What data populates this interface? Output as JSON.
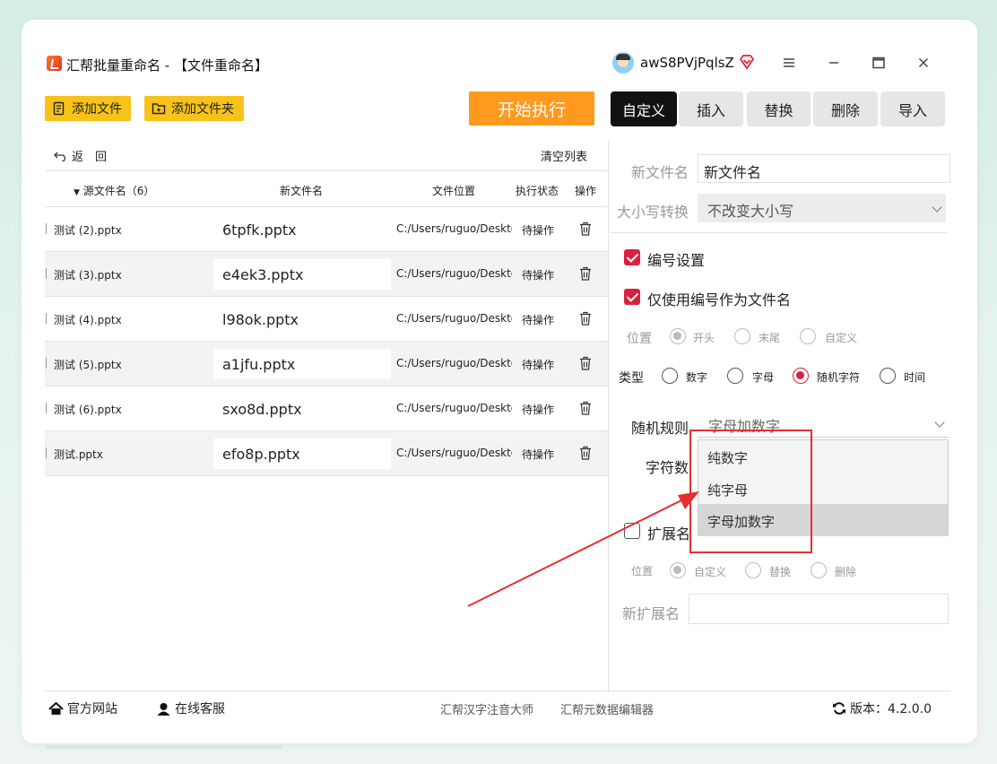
{
  "window": {
    "title": "汇帮批量重命名 - 【文件重命名】",
    "username": "awS8PVjPqlsZ"
  },
  "toolbar": {
    "add_file": "添加文件",
    "add_folder": "添加文件夹",
    "execute": "开始执行"
  },
  "tabs": [
    "自定义",
    "插入",
    "替换",
    "删除",
    "导入"
  ],
  "list": {
    "back": "返　回",
    "clear": "清空列表",
    "headers": {
      "source": "源文件名（6）",
      "new_name": "新文件名",
      "location": "文件位置",
      "status": "执行状态",
      "action": "操作"
    },
    "rows": [
      {
        "source": "测试 (2).pptx",
        "new_name": "6tpfk.pptx",
        "location": "C:/Users/ruguo/Desktop",
        "status": "待操作"
      },
      {
        "source": "测试 (3).pptx",
        "new_name": "e4ek3.pptx",
        "location": "C:/Users/ruguo/Desktop",
        "status": "待操作"
      },
      {
        "source": "测试 (4).pptx",
        "new_name": "l98ok.pptx",
        "location": "C:/Users/ruguo/Desktop",
        "status": "待操作"
      },
      {
        "source": "测试 (5).pptx",
        "new_name": "a1jfu.pptx",
        "location": "C:/Users/ruguo/Desktop",
        "status": "待操作"
      },
      {
        "source": "测试 (6).pptx",
        "new_name": "sxo8d.pptx",
        "location": "C:/Users/ruguo/Desktop",
        "status": "待操作"
      },
      {
        "source": "测试.pptx",
        "new_name": "efo8p.pptx",
        "location": "C:/Users/ruguo/Desktop",
        "status": "待操作"
      }
    ]
  },
  "panel": {
    "new_name_label": "新文件名",
    "new_name_value": "新文件名",
    "case_label": "大小写转换",
    "case_value": "不改变大小写",
    "numbering_label": "编号设置",
    "only_number_label": "仅使用编号作为文件名",
    "position_label": "位置",
    "position_options": [
      "开头",
      "末尾",
      "自定义"
    ],
    "type_label": "类型",
    "type_options": [
      "数字",
      "字母",
      "随机字符",
      "时间"
    ],
    "random_rule_label": "随机规则",
    "random_rule_value": "字母加数字",
    "char_count_label": "字符数",
    "dropdown_options": [
      "纯数字",
      "纯字母",
      "字母加数字"
    ],
    "ext_label": "扩展名",
    "ext_position_label": "位置",
    "ext_position_options": [
      "自定义",
      "替换",
      "删除"
    ],
    "new_ext_label": "新扩展名"
  },
  "footer": {
    "website": "官方网站",
    "support": "在线客服",
    "link1": "汇帮汉字注音大师",
    "link2": "汇帮元数据编辑器",
    "version": "版本：4.2.0.0"
  },
  "colors": {
    "accent_yellow": "#f7c21a",
    "exec_orange": "#ff9a1f",
    "check_red": "#d9213f",
    "annotation_red": "#e53030"
  }
}
